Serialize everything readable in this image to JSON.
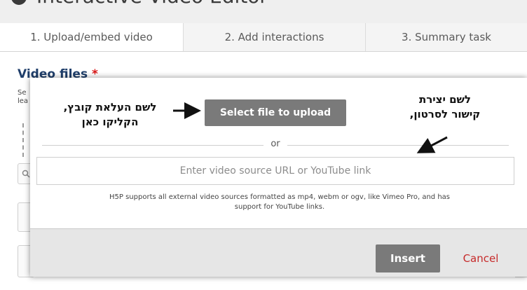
{
  "editor": {
    "title": "Interactive Video Editor"
  },
  "tabs": [
    {
      "label": "1. Upload/embed video",
      "active": true
    },
    {
      "label": "2. Add interactions",
      "active": false
    },
    {
      "label": "3. Summary task",
      "active": false
    }
  ],
  "field": {
    "label": "Video files",
    "required_marker": "*",
    "desc_line1": "Se",
    "desc_line2": "lea"
  },
  "modal": {
    "upload_button": "Select file to upload",
    "or_text": "or",
    "url_placeholder": "Enter video source URL or YouTube link",
    "support_text_line1": "H5P supports all external video sources formatted as mp4, webm or ogv, like Vimeo Pro, and has",
    "support_text_line2": "support for YouTube links.",
    "insert_button": "Insert",
    "cancel_link": "Cancel"
  },
  "annotations": {
    "left_line1": "לשם העלאת קובץ,",
    "left_line2": "הקליקו כאן",
    "right_line1": "לשם יצירת",
    "right_line2": "קישור לסרטון,"
  },
  "colors": {
    "heading": "#1f3e6a",
    "required": "#d81515",
    "button_gray": "#7a7a7a",
    "cancel_red": "#c62a2a",
    "footer_gray": "#e6e6e6"
  }
}
